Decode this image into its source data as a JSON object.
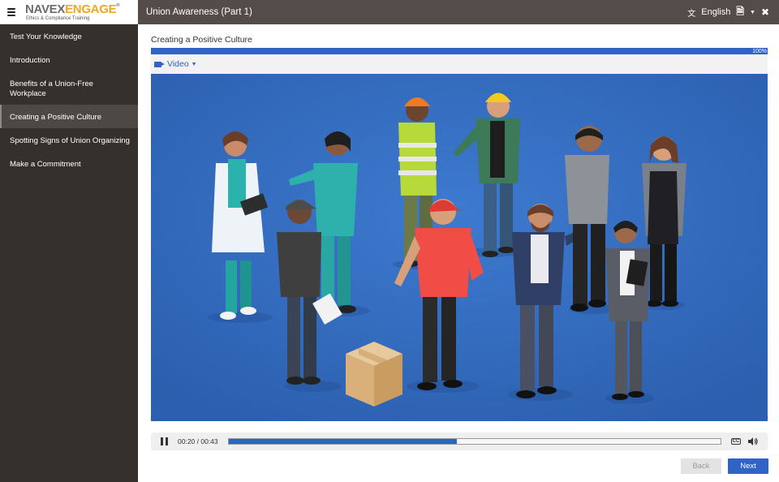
{
  "logo": {
    "navex": "NAVEX",
    "engage": "ENGAGE",
    "reg": "®",
    "tagline": "Ethics & Compliance Training"
  },
  "header": {
    "course_title": "Union Awareness (Part 1)",
    "language": "English"
  },
  "sidebar": {
    "items": [
      {
        "label": "Test Your Knowledge",
        "active": false
      },
      {
        "label": "Introduction",
        "active": false
      },
      {
        "label": "Benefits of a Union-Free Workplace",
        "active": false
      },
      {
        "label": "Creating a Positive Culture",
        "active": true
      },
      {
        "label": "Spotting Signs of Union Organizing",
        "active": false
      },
      {
        "label": "Make a Commitment",
        "active": false
      }
    ]
  },
  "main": {
    "heading": "Creating a Positive Culture",
    "progress": {
      "percent_label": "100%",
      "fraction": 1.0
    },
    "media_menu_label": "Video"
  },
  "player": {
    "time": "00:20 / 00:43",
    "played_fraction": 0.465,
    "cc_label": "CC"
  },
  "nav": {
    "back_label": "Back",
    "next_label": "Next"
  },
  "colors": {
    "accent": "#2f63c5",
    "sidebar_bg": "#36302d",
    "topbar_bg": "#534c48",
    "video_bg": "#346ebf"
  },
  "icons": [
    "hamburger-icon",
    "translate-icon",
    "document-icon",
    "close-icon",
    "video-camera-icon",
    "pause-icon",
    "closed-captions-icon",
    "volume-icon"
  ]
}
